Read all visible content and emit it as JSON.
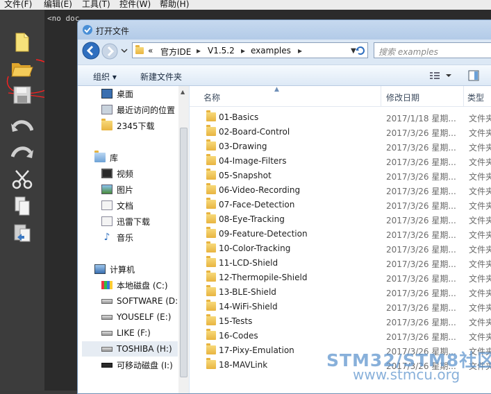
{
  "menubar": {
    "items": [
      "文件(F)",
      "编辑(E)",
      "工具(T)",
      "控件(W)",
      "帮助(H)"
    ]
  },
  "editor": {
    "tab_label": "<no doc..."
  },
  "toolbar": {
    "icons": [
      "new-file-icon",
      "open-folder-icon",
      "save-icon",
      "undo-icon",
      "redo-icon",
      "cut-icon",
      "copy-icon",
      "paste-icon"
    ]
  },
  "dialog": {
    "title": "打开文件",
    "address": {
      "prefix": "«",
      "crumbs": [
        "官方IDE",
        "V1.5.2",
        "examples"
      ]
    },
    "search_placeholder": "搜索 examples",
    "commands": {
      "organize": "组织 ▾",
      "new_folder": "新建文件夹"
    },
    "nav": [
      {
        "label": "桌面",
        "icon": "desktop-icon"
      },
      {
        "label": "最近访问的位置",
        "icon": "recent-icon"
      },
      {
        "label": "2345下载",
        "icon": "folder-icon"
      },
      {
        "label": "库",
        "icon": "library-icon"
      },
      {
        "label": "视频",
        "icon": "video-icon"
      },
      {
        "label": "图片",
        "icon": "picture-icon"
      },
      {
        "label": "文档",
        "icon": "document-icon"
      },
      {
        "label": "迅雷下载",
        "icon": "download-icon"
      },
      {
        "label": "音乐",
        "icon": "music-icon"
      },
      {
        "label": "计算机",
        "icon": "computer-icon"
      },
      {
        "label": "本地磁盘 (C:)",
        "icon": "drive-c-icon"
      },
      {
        "label": "SOFTWARE (D:)",
        "icon": "drive-icon"
      },
      {
        "label": "YOUSELF (E:)",
        "icon": "drive-icon"
      },
      {
        "label": "LIKE (F:)",
        "icon": "drive-icon"
      },
      {
        "label": "TOSHIBA (H:)",
        "icon": "drive-icon"
      },
      {
        "label": "可移动磁盘 (I:)",
        "icon": "removable-drive-icon"
      }
    ],
    "columns": {
      "name": "名称",
      "date": "修改日期",
      "type": "类型"
    },
    "files": [
      {
        "name": "01-Basics",
        "date": "2017/1/18 星期...",
        "type": "文件夹"
      },
      {
        "name": "02-Board-Control",
        "date": "2017/3/26 星期...",
        "type": "文件夹"
      },
      {
        "name": "03-Drawing",
        "date": "2017/3/26 星期...",
        "type": "文件夹"
      },
      {
        "name": "04-Image-Filters",
        "date": "2017/3/26 星期...",
        "type": "文件夹"
      },
      {
        "name": "05-Snapshot",
        "date": "2017/3/26 星期...",
        "type": "文件夹"
      },
      {
        "name": "06-Video-Recording",
        "date": "2017/3/26 星期...",
        "type": "文件夹"
      },
      {
        "name": "07-Face-Detection",
        "date": "2017/3/26 星期...",
        "type": "文件夹"
      },
      {
        "name": "08-Eye-Tracking",
        "date": "2017/3/26 星期...",
        "type": "文件夹"
      },
      {
        "name": "09-Feature-Detection",
        "date": "2017/3/26 星期...",
        "type": "文件夹"
      },
      {
        "name": "10-Color-Tracking",
        "date": "2017/3/26 星期...",
        "type": "文件夹"
      },
      {
        "name": "11-LCD-Shield",
        "date": "2017/3/26 星期...",
        "type": "文件夹"
      },
      {
        "name": "12-Thermopile-Shield",
        "date": "2017/3/26 星期...",
        "type": "文件夹"
      },
      {
        "name": "13-BLE-Shield",
        "date": "2017/3/26 星期...",
        "type": "文件夹"
      },
      {
        "name": "14-WiFi-Shield",
        "date": "2017/3/26 星期...",
        "type": "文件夹"
      },
      {
        "name": "15-Tests",
        "date": "2017/3/26 星期...",
        "type": "文件夹"
      },
      {
        "name": "16-Codes",
        "date": "2017/3/26 星期...",
        "type": "文件夹"
      },
      {
        "name": "17-Pixy-Emulation",
        "date": "2017/3/26 星期...",
        "type": "文件夹"
      },
      {
        "name": "18-MAVLink",
        "date": "2017/3/26 星期...",
        "type": "文件夹"
      }
    ]
  },
  "watermark": {
    "line1": "STM32/STM8社区",
    "line2": "www.stmcu.org"
  },
  "colors": {
    "annotation": "#ff2020",
    "accent": "#3a78c2",
    "folder": "#e8b440"
  }
}
